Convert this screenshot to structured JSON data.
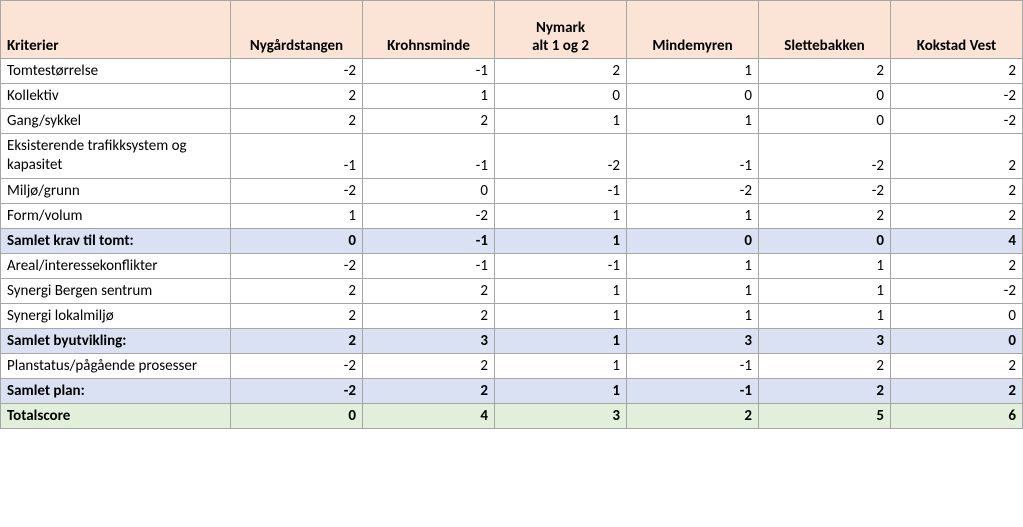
{
  "headers": {
    "kriterier": "Kriterier",
    "cols": [
      "Nygårdstangen",
      "Krohnsminde",
      "Nymark\nalt 1 og 2",
      "Mindemyren",
      "Slettebakken",
      "Kokstad Vest"
    ]
  },
  "rows": [
    {
      "type": "data",
      "label": "Tomtestørrelse",
      "v": [
        -2,
        -1,
        2,
        1,
        2,
        2
      ]
    },
    {
      "type": "data",
      "label": "Kollektiv",
      "v": [
        2,
        1,
        0,
        0,
        0,
        -2
      ]
    },
    {
      "type": "data",
      "label": "Gang/sykkel",
      "v": [
        2,
        2,
        1,
        1,
        0,
        -2
      ]
    },
    {
      "type": "data",
      "label": "Eksisterende trafikksystem og kapasitet",
      "v": [
        -1,
        -1,
        -2,
        -1,
        -2,
        2
      ]
    },
    {
      "type": "data",
      "label": "Miljø/grunn",
      "v": [
        -2,
        0,
        -1,
        -2,
        -2,
        2
      ]
    },
    {
      "type": "data",
      "label": "Form/volum",
      "v": [
        1,
        -2,
        1,
        1,
        2,
        2
      ]
    },
    {
      "type": "subtotal",
      "label": "Samlet krav til tomt:",
      "v": [
        0,
        -1,
        1,
        0,
        0,
        4
      ]
    },
    {
      "type": "data",
      "label": "Areal/interessekonflikter",
      "v": [
        -2,
        -1,
        -1,
        1,
        1,
        2
      ]
    },
    {
      "type": "data",
      "label": "Synergi Bergen sentrum",
      "v": [
        2,
        2,
        1,
        1,
        1,
        -2
      ]
    },
    {
      "type": "data",
      "label": "Synergi lokalmiljø",
      "v": [
        2,
        2,
        1,
        1,
        1,
        0
      ]
    },
    {
      "type": "subtotal",
      "label": "Samlet byutvikling:",
      "v": [
        2,
        3,
        1,
        3,
        3,
        0
      ]
    },
    {
      "type": "data",
      "label": "Planstatus/pågående prosesser",
      "v": [
        -2,
        2,
        1,
        -1,
        2,
        2
      ]
    },
    {
      "type": "subtotal",
      "label": "Samlet plan:",
      "v": [
        -2,
        2,
        1,
        -1,
        2,
        2
      ]
    },
    {
      "type": "total",
      "label": "Totalscore",
      "v": [
        0,
        4,
        3,
        2,
        5,
        6
      ]
    }
  ],
  "chart_data": {
    "type": "table",
    "title": "Kriterier score matrix",
    "columns": [
      "Nygårdstangen",
      "Krohnsminde",
      "Nymark alt 1 og 2",
      "Mindemyren",
      "Slettebakken",
      "Kokstad Vest"
    ],
    "categories": [
      "Tomtestørrelse",
      "Kollektiv",
      "Gang/sykkel",
      "Eksisterende trafikksystem og kapasitet",
      "Miljø/grunn",
      "Form/volum",
      "Samlet krav til tomt:",
      "Areal/interessekonflikter",
      "Synergi Bergen sentrum",
      "Synergi lokalmiljø",
      "Samlet byutvikling:",
      "Planstatus/pågående prosesser",
      "Samlet plan:",
      "Totalscore"
    ],
    "values": [
      [
        -2,
        -1,
        2,
        1,
        2,
        2
      ],
      [
        2,
        1,
        0,
        0,
        0,
        -2
      ],
      [
        2,
        2,
        1,
        1,
        0,
        -2
      ],
      [
        -1,
        -1,
        -2,
        -1,
        -2,
        2
      ],
      [
        -2,
        0,
        -1,
        -2,
        -2,
        2
      ],
      [
        1,
        -2,
        1,
        1,
        2,
        2
      ],
      [
        0,
        -1,
        1,
        0,
        0,
        4
      ],
      [
        -2,
        -1,
        -1,
        1,
        1,
        2
      ],
      [
        2,
        2,
        1,
        1,
        1,
        -2
      ],
      [
        2,
        2,
        1,
        1,
        1,
        0
      ],
      [
        2,
        3,
        1,
        3,
        3,
        0
      ],
      [
        -2,
        2,
        1,
        -1,
        2,
        2
      ],
      [
        -2,
        2,
        1,
        -1,
        2,
        2
      ],
      [
        0,
        4,
        3,
        2,
        5,
        6
      ]
    ]
  }
}
